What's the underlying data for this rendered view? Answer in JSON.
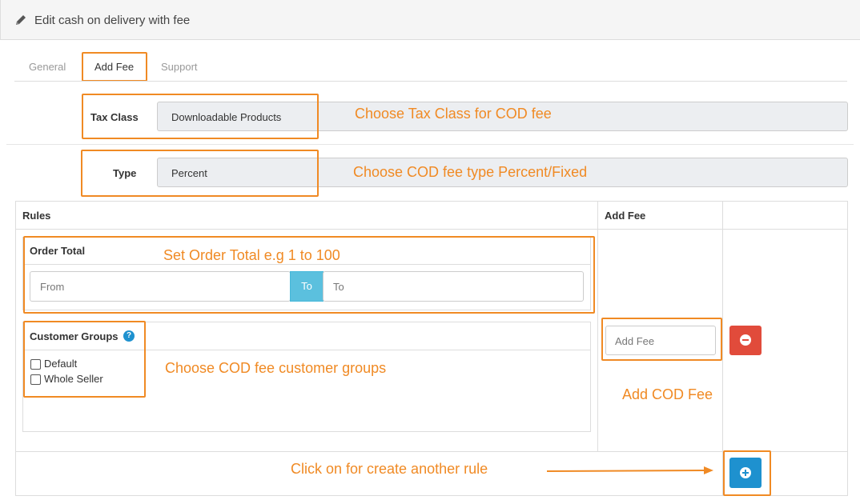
{
  "panel": {
    "title": "Edit cash on delivery with fee"
  },
  "tabs": [
    {
      "label": "General"
    },
    {
      "label": "Add Fee"
    },
    {
      "label": "Support"
    }
  ],
  "tax_class": {
    "label": "Tax Class",
    "value": "Downloadable Products"
  },
  "type": {
    "label": "Type",
    "value": "Percent"
  },
  "rules_table": {
    "rules_header": "Rules",
    "add_fee_header": "Add Fee",
    "order_total": {
      "label": "Order Total",
      "from_placeholder": "From",
      "to_button": "To",
      "to_placeholder": "To"
    },
    "customer_groups": {
      "label": "Customer Groups",
      "options": [
        "Default",
        "Whole Seller"
      ]
    },
    "add_fee_placeholder": "Add Fee"
  },
  "annotations": {
    "tax_class": "Choose Tax Class for COD fee",
    "type": "Choose COD fee type Percent/Fixed",
    "order_total": "Set Order Total e.g 1 to 100",
    "customer_groups": "Choose COD fee customer groups",
    "add_fee": "Add COD Fee",
    "add_rule": "Click on for create another rule"
  },
  "colors": {
    "highlight": "#f08a24",
    "info": "#5bc0de",
    "danger": "#e14b3b",
    "primary": "#1e91cf"
  }
}
